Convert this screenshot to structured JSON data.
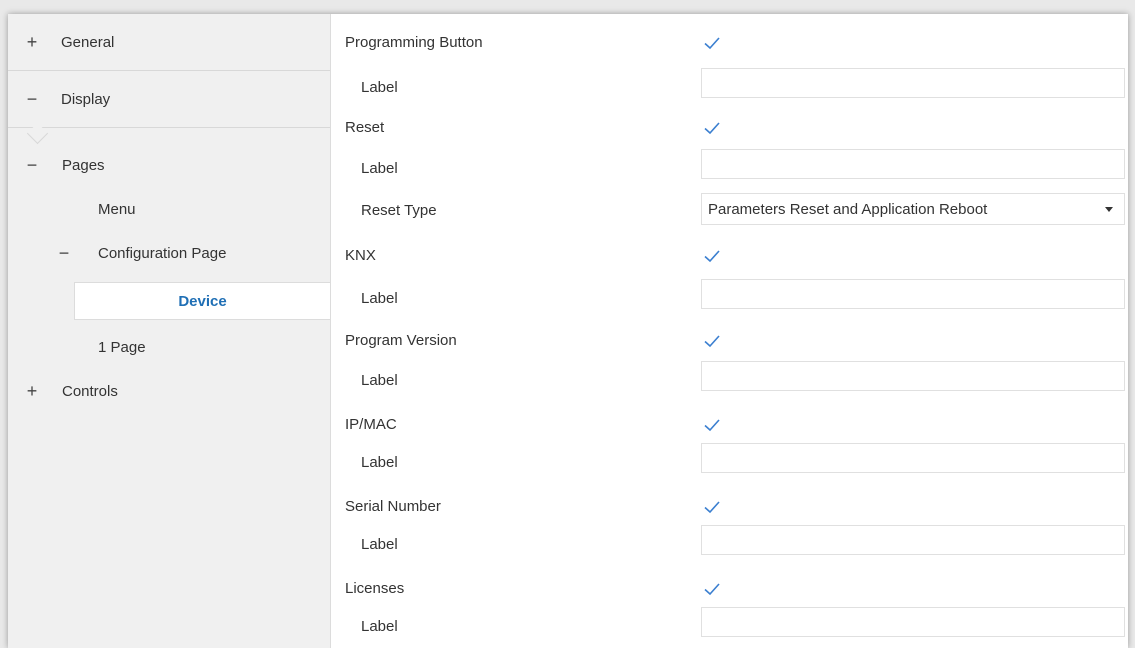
{
  "sidebar": {
    "general": {
      "sign": "+",
      "label": "General"
    },
    "display": {
      "sign": "−",
      "label": "Display"
    },
    "pages": {
      "sign": "−",
      "label": "Pages"
    },
    "menu": {
      "label": "Menu"
    },
    "configuration_page": {
      "sign": "−",
      "label": "Configuration Page"
    },
    "device": {
      "label": "Device"
    },
    "one_page": {
      "label": "1 Page"
    },
    "controls": {
      "sign": "+",
      "label": "Controls"
    }
  },
  "form": {
    "programming_button": {
      "label": "Programming Button",
      "checked": true
    },
    "programming_button_label": {
      "label": "Label",
      "value": ""
    },
    "reset": {
      "label": "Reset",
      "checked": true
    },
    "reset_label": {
      "label": "Label",
      "value": ""
    },
    "reset_type": {
      "label": "Reset Type",
      "value": "Parameters Reset and Application Reboot"
    },
    "knx": {
      "label": "KNX",
      "checked": true
    },
    "knx_label": {
      "label": "Label",
      "value": ""
    },
    "program_version": {
      "label": "Program Version",
      "checked": true
    },
    "program_version_label": {
      "label": "Label",
      "value": ""
    },
    "ip_mac": {
      "label": "IP/MAC",
      "checked": true
    },
    "ip_mac_label": {
      "label": "Label",
      "value": ""
    },
    "serial_number": {
      "label": "Serial Number",
      "checked": true
    },
    "serial_number_label": {
      "label": "Label",
      "value": ""
    },
    "licenses": {
      "label": "Licenses",
      "checked": true
    },
    "licenses_label": {
      "label": "Label",
      "value": ""
    }
  },
  "colors": {
    "accent": "#1f6fb5",
    "check": "#3b7fd0"
  },
  "icons": {
    "check": "checkmark-icon",
    "dropdown": "dropdown-arrow-icon"
  }
}
